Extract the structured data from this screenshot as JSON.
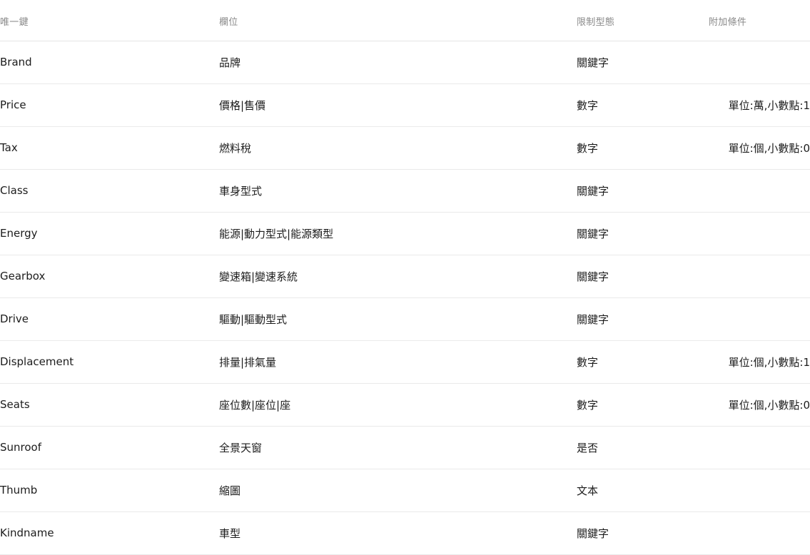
{
  "table": {
    "columns": [
      {
        "key": "unique_key",
        "label": "唯一鍵"
      },
      {
        "key": "field",
        "label": "欄位"
      },
      {
        "key": "type",
        "label": "限制型態"
      },
      {
        "key": "extra",
        "label": "附加條件"
      }
    ],
    "rows": [
      {
        "unique_key": "Brand",
        "field": "品牌",
        "type": "關鍵字",
        "extra": ""
      },
      {
        "unique_key": "Price",
        "field": "價格|售價",
        "type": "數字",
        "extra": "單位:萬,小數點:1"
      },
      {
        "unique_key": "Tax",
        "field": "燃料稅",
        "type": "數字",
        "extra": "單位:個,小數點:0"
      },
      {
        "unique_key": "Class",
        "field": "車身型式",
        "type": "關鍵字",
        "extra": ""
      },
      {
        "unique_key": "Energy",
        "field": "能源|動力型式|能源類型",
        "type": "關鍵字",
        "extra": ""
      },
      {
        "unique_key": "Gearbox",
        "field": "變速箱|變速系統",
        "type": "關鍵字",
        "extra": ""
      },
      {
        "unique_key": "Drive",
        "field": "驅動|驅動型式",
        "type": "關鍵字",
        "extra": ""
      },
      {
        "unique_key": "Displacement",
        "field": "排量|排氣量",
        "type": "數字",
        "extra": "單位:個,小數點:1"
      },
      {
        "unique_key": "Seats",
        "field": "座位數|座位|座",
        "type": "數字",
        "extra": "單位:個,小數點:0"
      },
      {
        "unique_key": "Sunroof",
        "field": "全景天窗",
        "type": "是否",
        "extra": ""
      },
      {
        "unique_key": "Thumb",
        "field": "縮圖",
        "type": "文本",
        "extra": ""
      },
      {
        "unique_key": "Kindname",
        "field": "車型",
        "type": "關鍵字",
        "extra": ""
      }
    ]
  },
  "colors": {
    "header_text": "#8a8a8a",
    "body_text": "#1c1c1c",
    "row_border": "#eaeaea",
    "header_border": "#e6e6e6",
    "background": "#ffffff"
  }
}
